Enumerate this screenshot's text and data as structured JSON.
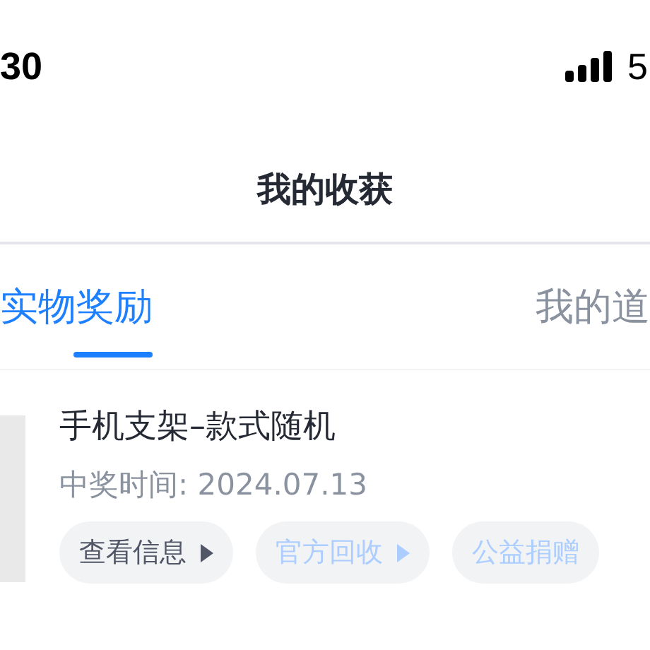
{
  "status_bar": {
    "time": "30",
    "battery": "5"
  },
  "header": {
    "title": "我的收获"
  },
  "tabs": [
    {
      "label": "实物奖励",
      "selected": true
    },
    {
      "label": "我的道",
      "selected": false
    }
  ],
  "prizes": [
    {
      "name": "手机支架–款式随机",
      "date": "中奖时间: 2024.07.13",
      "buttons": [
        {
          "label": "查看信息",
          "disabled": false,
          "arrow": true
        },
        {
          "label": "官方回收",
          "disabled": true,
          "arrow": true
        },
        {
          "label": "公益捐赠",
          "disabled": true,
          "arrow": false
        }
      ]
    }
  ]
}
